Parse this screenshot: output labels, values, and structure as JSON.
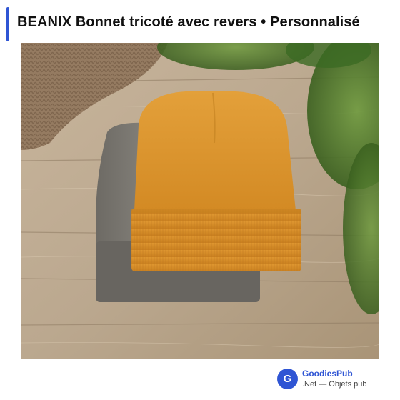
{
  "header": {
    "title": "BEANIX Bonnet tricoté avec revers • Personnalisé",
    "accent_color": "#2f55d4"
  },
  "image": {
    "subject": "product-photo-beanie"
  },
  "footer": {
    "logo_letter": "G",
    "brand_name": "GoodiesPub",
    "brand_tagline": ".Net — Objets pub",
    "brand_color": "#2f55d4"
  }
}
